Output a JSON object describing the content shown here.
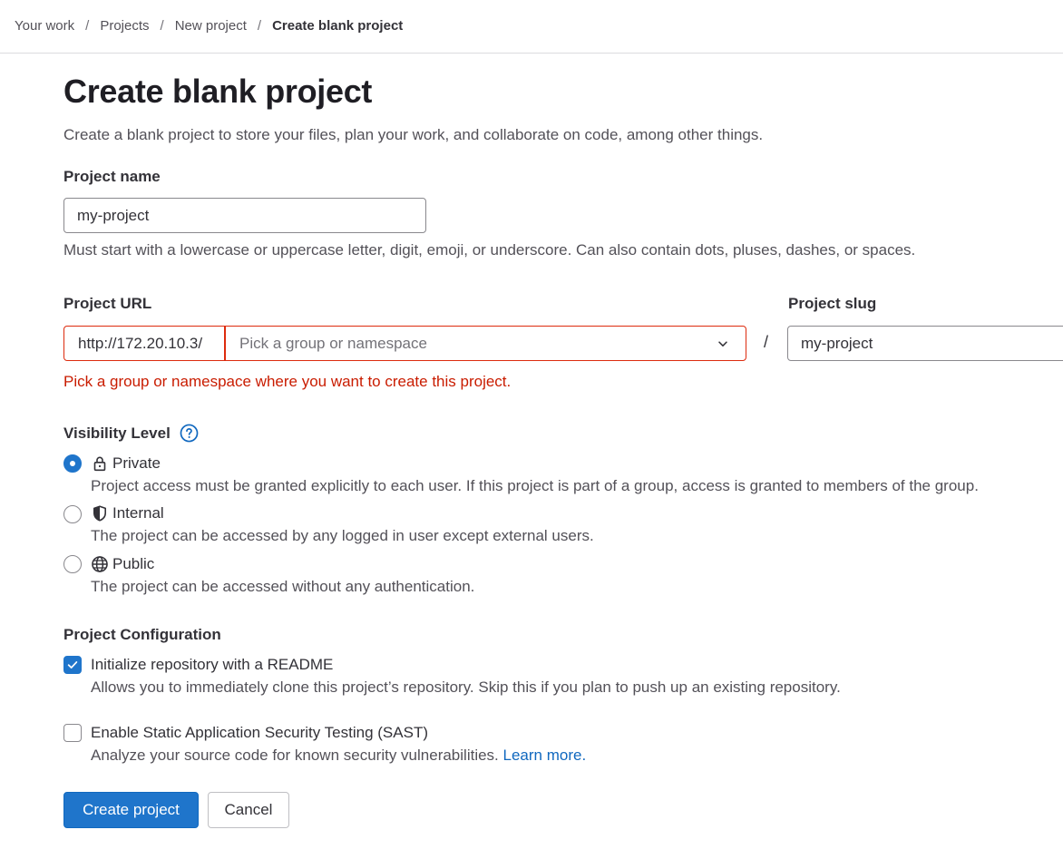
{
  "breadcrumbs": [
    {
      "label": "Your work"
    },
    {
      "label": "Projects"
    },
    {
      "label": "New project"
    },
    {
      "label": "Create blank project"
    }
  ],
  "breadcrumb_separator": "/",
  "page": {
    "title": "Create blank project",
    "description": "Create a blank project to store your files, plan your work, and collaborate on code, among other things."
  },
  "project_name": {
    "label": "Project name",
    "value": "my-project",
    "help": "Must start with a lowercase or uppercase letter, digit, emoji, or underscore. Can also contain dots, pluses, dashes, or spaces."
  },
  "project_url": {
    "label": "Project URL",
    "prefix": "http://172.20.10.3/",
    "namespace_placeholder": "Pick a group or namespace",
    "separator": "/",
    "error": "Pick a group or namespace where you want to create this project."
  },
  "project_slug": {
    "label": "Project slug",
    "value": "my-project"
  },
  "visibility": {
    "label": "Visibility Level",
    "selected": "Private",
    "options": [
      {
        "label": "Private",
        "icon": "lock-icon",
        "description": "Project access must be granted explicitly to each user. If this project is part of a group, access is granted to members of the group."
      },
      {
        "label": "Internal",
        "icon": "shield-icon",
        "description": "The project can be accessed by any logged in user except external users."
      },
      {
        "label": "Public",
        "icon": "globe-icon",
        "description": "The project can be accessed without any authentication."
      }
    ]
  },
  "configuration": {
    "label": "Project Configuration",
    "readme": {
      "label": "Initialize repository with a README",
      "checked": true,
      "description": "Allows you to immediately clone this project’s repository. Skip this if you plan to push up an existing repository."
    },
    "sast": {
      "label": "Enable Static Application Security Testing (SAST)",
      "checked": false,
      "description": "Analyze your source code for known security vulnerabilities.",
      "link": "Learn more."
    }
  },
  "actions": {
    "create_label": "Create project",
    "cancel_label": "Cancel"
  },
  "colors": {
    "primary": "#1f75cb",
    "link": "#1068bf",
    "error": "#dd2b0e",
    "text": "#333238"
  }
}
